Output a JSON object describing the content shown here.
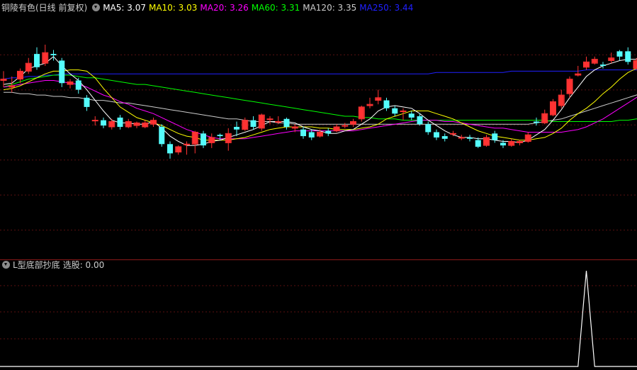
{
  "header": {
    "stock_name": "铜陵有色(日线 前复权)",
    "ma": [
      {
        "label": "MA5: 3.07",
        "color": "#ffffff"
      },
      {
        "label": "MA10: 3.03",
        "color": "#ffff00"
      },
      {
        "label": "MA20: 3.26",
        "color": "#ff00ff"
      },
      {
        "label": "MA60: 3.31",
        "color": "#00ff00"
      },
      {
        "label": "MA120: 3.35",
        "color": "#cccccc"
      },
      {
        "label": "MA250: 3.44",
        "color": "#2020ff"
      }
    ]
  },
  "indicator_header": {
    "name": "L型底部抄底",
    "value_label": "选股: 0.00"
  },
  "chart_data": [
    {
      "type": "candlestick",
      "title": "铜陵有色(日线 前复权)",
      "high_marker": "3.78",
      "colors": {
        "up": "#ff3232",
        "down": "#54fcfc",
        "ma5": "#ffffff",
        "ma10": "#ffff00",
        "ma20": "#ff00ff",
        "ma60": "#00ff00",
        "ma120": "#cccccc",
        "ma250": "#2020ff"
      },
      "ylim": [
        2.0,
        3.85
      ],
      "candles": [
        [
          3.35,
          3.36,
          3.42,
          3.3
        ],
        [
          3.3,
          3.31,
          3.38,
          3.26
        ],
        [
          3.36,
          3.42,
          3.44,
          3.33
        ],
        [
          3.42,
          3.48,
          3.52,
          3.4
        ],
        [
          3.55,
          3.45,
          3.6,
          3.43
        ],
        [
          3.48,
          3.56,
          3.62,
          3.46
        ],
        [
          3.55,
          3.54,
          3.58,
          3.5
        ],
        [
          3.5,
          3.33,
          3.52,
          3.3
        ],
        [
          3.32,
          3.34,
          3.36,
          3.29
        ],
        [
          3.35,
          3.28,
          3.37,
          3.25
        ],
        [
          3.22,
          3.15,
          3.24,
          3.12
        ],
        [
          3.05,
          3.05,
          3.08,
          3.01
        ],
        [
          3.05,
          3.01,
          3.07,
          2.99
        ],
        [
          3.0,
          3.04,
          3.06,
          2.98
        ],
        [
          3.07,
          3.0,
          3.09,
          2.98
        ],
        [
          3.0,
          3.04,
          3.06,
          2.99
        ],
        [
          3.01,
          3.03,
          3.04,
          2.99
        ],
        [
          3.0,
          3.03,
          3.05,
          2.99
        ],
        [
          3.02,
          3.05,
          3.07,
          3.0
        ],
        [
          3.0,
          2.87,
          3.02,
          2.85
        ],
        [
          2.87,
          2.8,
          2.89,
          2.76
        ],
        [
          2.81,
          2.85,
          2.86,
          2.79
        ],
        [
          2.87,
          2.87,
          2.89,
          2.79
        ],
        [
          2.87,
          2.96,
          2.97,
          2.8
        ],
        [
          2.95,
          2.86,
          2.97,
          2.84
        ],
        [
          2.88,
          2.92,
          2.95,
          2.84
        ],
        [
          2.94,
          2.93,
          2.95,
          2.9
        ],
        [
          2.88,
          2.95,
          2.99,
          2.82
        ],
        [
          3.0,
          2.98,
          3.04,
          2.93
        ],
        [
          2.98,
          3.05,
          3.07,
          2.97
        ],
        [
          3.05,
          3.0,
          3.08,
          2.98
        ],
        [
          2.99,
          3.09,
          3.1,
          2.97
        ],
        [
          3.06,
          3.06,
          3.08,
          3.02
        ],
        [
          3.04,
          3.04,
          3.08,
          3.02
        ],
        [
          3.06,
          3.0,
          3.07,
          2.98
        ],
        [
          2.99,
          3.0,
          3.02,
          2.96
        ],
        [
          2.98,
          2.93,
          3.0,
          2.91
        ],
        [
          2.96,
          2.92,
          2.98,
          2.9
        ],
        [
          2.93,
          2.96,
          2.98,
          2.92
        ],
        [
          2.97,
          2.95,
          2.99,
          2.93
        ],
        [
          2.97,
          3.0,
          3.02,
          2.96
        ],
        [
          3.01,
          3.01,
          3.03,
          2.99
        ],
        [
          3.02,
          3.04,
          3.06,
          3.0
        ],
        [
          3.06,
          3.15,
          3.16,
          3.04
        ],
        [
          3.16,
          3.17,
          3.22,
          3.14
        ],
        [
          3.2,
          3.22,
          3.28,
          3.17
        ],
        [
          3.2,
          3.14,
          3.22,
          3.12
        ],
        [
          3.14,
          3.1,
          3.16,
          3.08
        ],
        [
          3.12,
          3.12,
          3.14,
          3.05
        ],
        [
          3.1,
          3.07,
          3.12,
          3.05
        ],
        [
          3.08,
          3.02,
          3.1,
          3.01
        ],
        [
          3.02,
          2.96,
          3.04,
          2.94
        ],
        [
          2.96,
          2.92,
          2.98,
          2.9
        ],
        [
          2.93,
          2.91,
          2.95,
          2.89
        ],
        [
          2.95,
          2.95,
          2.97,
          2.93
        ],
        [
          2.92,
          2.92,
          2.94,
          2.9
        ],
        [
          2.92,
          2.91,
          2.94,
          2.89
        ],
        [
          2.9,
          2.85,
          2.92,
          2.84
        ],
        [
          2.86,
          2.92,
          2.94,
          2.85
        ],
        [
          2.95,
          2.9,
          2.97,
          2.88
        ],
        [
          2.88,
          2.86,
          2.9,
          2.84
        ],
        [
          2.86,
          2.89,
          2.91,
          2.85
        ],
        [
          2.88,
          2.89,
          2.9,
          2.86
        ],
        [
          2.89,
          2.94,
          2.96,
          2.88
        ],
        [
          3.04,
          3.03,
          3.07,
          3.01
        ],
        [
          3.03,
          3.1,
          3.13,
          3.02
        ],
        [
          3.09,
          3.19,
          3.21,
          3.08
        ],
        [
          3.16,
          3.24,
          3.28,
          3.14
        ],
        [
          3.25,
          3.36,
          3.38,
          3.22
        ],
        [
          3.39,
          3.4,
          3.46,
          3.38
        ],
        [
          3.45,
          3.49,
          3.53,
          3.43
        ],
        [
          3.48,
          3.51,
          3.53,
          3.47
        ],
        [
          3.47,
          3.46,
          3.49,
          3.44
        ],
        [
          3.5,
          3.52,
          3.56,
          3.48
        ],
        [
          3.57,
          3.53,
          3.58,
          3.5
        ],
        [
          3.57,
          3.49,
          3.6,
          3.47
        ],
        [
          3.44,
          3.5,
          3.52,
          3.43
        ],
        [
          3.49,
          3.72,
          3.75,
          3.47
        ],
        [
          3.65,
          3.65,
          3.67,
          3.63
        ],
        [
          3.75,
          3.64,
          3.78,
          3.58
        ],
        [
          3.5,
          3.5,
          3.52,
          3.45
        ],
        [
          3.42,
          3.36,
          3.45,
          3.25
        ],
        [
          3.38,
          3.38,
          3.4,
          3.36
        ]
      ],
      "ma": {
        "ma5": [
          3.32,
          3.33,
          3.38,
          3.44,
          3.46,
          3.48,
          3.53,
          3.46,
          3.4,
          3.35,
          3.28,
          3.2,
          3.12,
          3.05,
          3.03,
          3.03,
          3.02,
          3.02,
          3.04,
          2.99,
          2.93,
          2.89,
          2.86,
          2.86,
          2.87,
          2.89,
          2.9,
          2.92,
          2.94,
          2.96,
          2.98,
          3.01,
          3.04,
          3.04,
          3.04,
          3.03,
          3.0,
          2.98,
          2.97,
          2.95,
          2.95,
          2.97,
          2.98,
          3.02,
          3.06,
          3.12,
          3.15,
          3.16,
          3.15,
          3.14,
          3.1,
          3.05,
          3.01,
          2.97,
          2.94,
          2.92,
          2.92,
          2.91,
          2.91,
          2.9,
          2.89,
          2.89,
          2.88,
          2.9,
          2.94,
          2.98,
          3.05,
          3.13,
          3.22,
          3.3,
          3.38,
          3.43,
          3.46,
          3.48,
          3.5,
          3.51,
          3.51,
          3.56,
          3.61,
          3.62,
          3.6,
          3.56,
          3.5
        ],
        "ma10": [
          3.28,
          3.29,
          3.31,
          3.34,
          3.37,
          3.4,
          3.42,
          3.42,
          3.43,
          3.43,
          3.42,
          3.37,
          3.29,
          3.22,
          3.15,
          3.11,
          3.07,
          3.05,
          3.03,
          3.01,
          2.98,
          2.95,
          2.93,
          2.92,
          2.9,
          2.9,
          2.9,
          2.9,
          2.91,
          2.92,
          2.94,
          2.96,
          2.98,
          2.99,
          3.0,
          3.0,
          3.0,
          3.0,
          2.99,
          2.99,
          2.98,
          2.98,
          2.98,
          2.99,
          3.0,
          3.02,
          3.06,
          3.08,
          3.1,
          3.12,
          3.12,
          3.12,
          3.1,
          3.08,
          3.06,
          3.03,
          3.0,
          2.97,
          2.95,
          2.93,
          2.92,
          2.91,
          2.9,
          2.9,
          2.91,
          2.92,
          2.95,
          2.99,
          3.05,
          3.1,
          3.14,
          3.19,
          3.25,
          3.3,
          3.36,
          3.41,
          3.44,
          3.47,
          3.51,
          3.54,
          3.55,
          3.55,
          3.55
        ],
        "ma20": [
          3.3,
          3.31,
          3.32,
          3.33,
          3.34,
          3.35,
          3.35,
          3.34,
          3.33,
          3.32,
          3.3,
          3.27,
          3.24,
          3.22,
          3.19,
          3.17,
          3.14,
          3.12,
          3.1,
          3.07,
          3.04,
          3.01,
          2.98,
          2.96,
          2.94,
          2.92,
          2.91,
          2.91,
          2.91,
          2.91,
          2.92,
          2.93,
          2.94,
          2.95,
          2.96,
          2.97,
          2.97,
          2.97,
          2.97,
          2.97,
          2.97,
          2.97,
          2.97,
          2.98,
          2.99,
          3.0,
          3.01,
          3.02,
          3.03,
          3.04,
          3.05,
          3.05,
          3.05,
          3.04,
          3.04,
          3.03,
          3.02,
          3.01,
          3.0,
          2.99,
          2.99,
          2.98,
          2.97,
          2.96,
          2.96,
          2.96,
          2.96,
          2.96,
          2.97,
          2.98,
          3.0,
          3.03,
          3.06,
          3.1,
          3.14,
          3.18,
          3.22,
          3.26,
          3.3,
          3.33,
          3.35,
          3.36,
          3.36
        ],
        "ma60": [
          3.3,
          3.32,
          3.34,
          3.36,
          3.37,
          3.38,
          3.39,
          3.39,
          3.39,
          3.38,
          3.37,
          3.37,
          3.36,
          3.35,
          3.34,
          3.33,
          3.32,
          3.32,
          3.31,
          3.3,
          3.29,
          3.28,
          3.27,
          3.26,
          3.25,
          3.24,
          3.23,
          3.22,
          3.21,
          3.2,
          3.19,
          3.18,
          3.17,
          3.16,
          3.15,
          3.14,
          3.13,
          3.12,
          3.11,
          3.1,
          3.09,
          3.08,
          3.08,
          3.07,
          3.07,
          3.06,
          3.06,
          3.06,
          3.05,
          3.05,
          3.05,
          3.05,
          3.05,
          3.05,
          3.05,
          3.05,
          3.05,
          3.05,
          3.05,
          3.05,
          3.05,
          3.05,
          3.05,
          3.05,
          3.05,
          3.05,
          3.04,
          3.04,
          3.04,
          3.04,
          3.04,
          3.04,
          3.04,
          3.04,
          3.05,
          3.05,
          3.06,
          3.06,
          3.07,
          3.08,
          3.09,
          3.1,
          3.11
        ],
        "ma120": [
          3.26,
          3.26,
          3.25,
          3.25,
          3.24,
          3.24,
          3.23,
          3.23,
          3.22,
          3.22,
          3.21,
          3.2,
          3.2,
          3.19,
          3.18,
          3.18,
          3.17,
          3.16,
          3.15,
          3.14,
          3.13,
          3.12,
          3.11,
          3.1,
          3.09,
          3.08,
          3.07,
          3.06,
          3.06,
          3.05,
          3.04,
          3.04,
          3.04,
          3.03,
          3.03,
          3.02,
          3.02,
          3.02,
          3.02,
          3.02,
          3.02,
          3.02,
          3.02,
          3.02,
          3.02,
          3.02,
          3.02,
          3.02,
          3.02,
          3.02,
          3.02,
          3.02,
          3.02,
          3.02,
          3.02,
          3.02,
          3.02,
          3.02,
          3.02,
          3.02,
          3.02,
          3.02,
          3.02,
          3.02,
          3.03,
          3.04,
          3.05,
          3.06,
          3.08,
          3.1,
          3.12,
          3.14,
          3.16,
          3.18,
          3.2,
          3.22,
          3.24,
          3.26,
          3.28,
          3.3,
          3.32,
          3.34,
          3.35
        ],
        "ma250": [
          3.36,
          3.37,
          3.37,
          3.38,
          3.38,
          3.39,
          3.39,
          3.4,
          3.4,
          3.4,
          3.4,
          3.4,
          3.4,
          3.4,
          3.4,
          3.4,
          3.4,
          3.4,
          3.4,
          3.4,
          3.4,
          3.4,
          3.4,
          3.4,
          3.4,
          3.4,
          3.4,
          3.4,
          3.4,
          3.4,
          3.4,
          3.4,
          3.4,
          3.4,
          3.4,
          3.4,
          3.4,
          3.4,
          3.4,
          3.4,
          3.4,
          3.4,
          3.4,
          3.4,
          3.4,
          3.4,
          3.4,
          3.4,
          3.4,
          3.4,
          3.4,
          3.4,
          3.41,
          3.41,
          3.41,
          3.41,
          3.41,
          3.41,
          3.41,
          3.41,
          3.41,
          3.42,
          3.42,
          3.42,
          3.42,
          3.42,
          3.42,
          3.42,
          3.42,
          3.42,
          3.43,
          3.43,
          3.43,
          3.43,
          3.43,
          3.43,
          3.43,
          3.44,
          3.44,
          3.44,
          3.44,
          3.44,
          3.44
        ]
      }
    },
    {
      "type": "line",
      "title": "L型底部抄底",
      "series": [
        {
          "name": "选股",
          "color": "#ffffff"
        }
      ],
      "ylim": [
        0,
        1
      ],
      "signal_index": 70,
      "signal_value": 1,
      "n": 83
    }
  ]
}
